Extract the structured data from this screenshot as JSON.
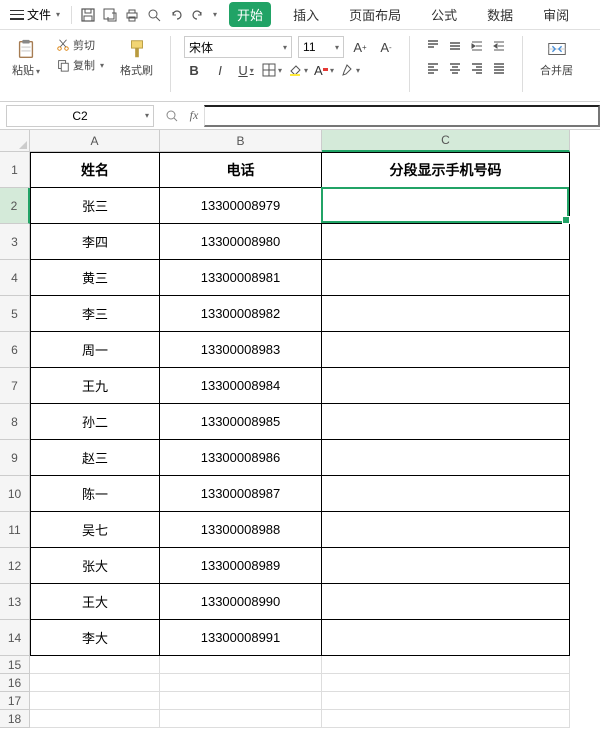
{
  "menu": {
    "file": "文件"
  },
  "tabs": [
    "开始",
    "插入",
    "页面布局",
    "公式",
    "数据",
    "审阅"
  ],
  "ribbon": {
    "paste": "粘贴",
    "cut": "剪切",
    "copy": "复制",
    "formatPainter": "格式刷",
    "font": "宋体",
    "fontSize": "11",
    "merge": "合并居"
  },
  "namebox": "C2",
  "columns": [
    "A",
    "B",
    "C"
  ],
  "headers": {
    "A": "姓名",
    "B": "电话",
    "C": "分段显示手机号码"
  },
  "rows": [
    {
      "n": "1"
    },
    {
      "n": "2",
      "A": "张三",
      "B": "13300008979",
      "C": ""
    },
    {
      "n": "3",
      "A": "李四",
      "B": "13300008980",
      "C": ""
    },
    {
      "n": "4",
      "A": "黄三",
      "B": "13300008981",
      "C": ""
    },
    {
      "n": "5",
      "A": "李三",
      "B": "13300008982",
      "C": ""
    },
    {
      "n": "6",
      "A": "周一",
      "B": "13300008983",
      "C": ""
    },
    {
      "n": "7",
      "A": "王九",
      "B": "13300008984",
      "C": ""
    },
    {
      "n": "8",
      "A": "孙二",
      "B": "13300008985",
      "C": ""
    },
    {
      "n": "9",
      "A": "赵三",
      "B": "13300008986",
      "C": ""
    },
    {
      "n": "10",
      "A": "陈一",
      "B": "13300008987",
      "C": ""
    },
    {
      "n": "11",
      "A": "吴七",
      "B": "13300008988",
      "C": ""
    },
    {
      "n": "12",
      "A": "张大",
      "B": "13300008989",
      "C": ""
    },
    {
      "n": "13",
      "A": "王大",
      "B": "13300008990",
      "C": ""
    },
    {
      "n": "14",
      "A": "李大",
      "B": "13300008991",
      "C": ""
    },
    {
      "n": "15"
    },
    {
      "n": "16"
    },
    {
      "n": "17"
    },
    {
      "n": "18"
    }
  ],
  "activeCell": {
    "row": 2,
    "col": "C"
  }
}
